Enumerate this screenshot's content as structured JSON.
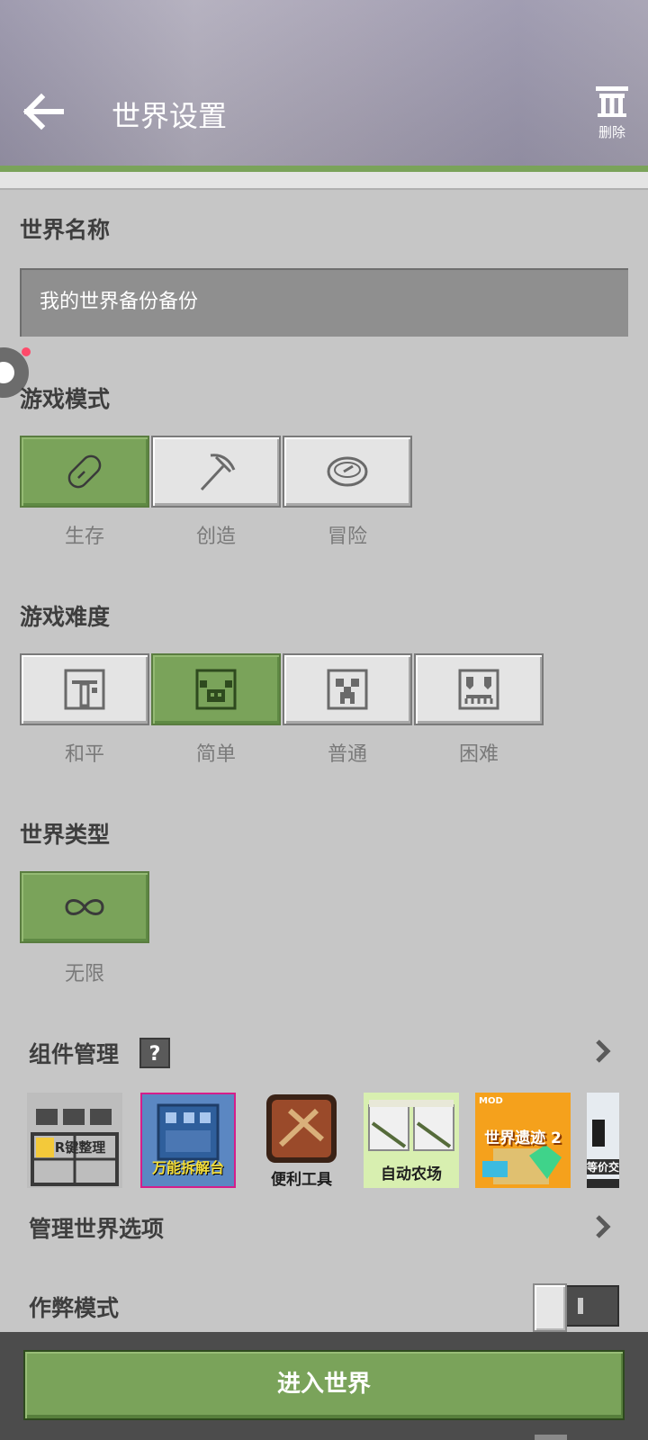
{
  "header": {
    "title": "世界设置",
    "delete_label": "删除"
  },
  "world_name": {
    "section_title": "世界名称",
    "value": "我的世界备份备份"
  },
  "game_mode": {
    "section_title": "游戏模式",
    "options": [
      {
        "label": "生存",
        "icon": "bread-icon",
        "selected": true
      },
      {
        "label": "创造",
        "icon": "pickaxe-icon",
        "selected": false
      },
      {
        "label": "冒险",
        "icon": "compass-icon",
        "selected": false
      }
    ]
  },
  "difficulty": {
    "section_title": "游戏难度",
    "options": [
      {
        "label": "和平",
        "icon": "peaceful-mob-icon",
        "selected": false
      },
      {
        "label": "简单",
        "icon": "pig-icon",
        "selected": true
      },
      {
        "label": "普通",
        "icon": "creeper-icon",
        "selected": false
      },
      {
        "label": "困难",
        "icon": "ghast-icon",
        "selected": false
      }
    ]
  },
  "world_type": {
    "section_title": "世界类型",
    "options": [
      {
        "label": "无限",
        "icon": "infinity-icon",
        "selected": true
      }
    ]
  },
  "components": {
    "title": "组件管理",
    "help": "?",
    "mods": [
      {
        "text": "R键整理",
        "name": "mod-r-key-sort"
      },
      {
        "text": "万能拆解台",
        "name": "mod-universal-disassembler"
      },
      {
        "text": "便利工具",
        "name": "mod-convenient-tools"
      },
      {
        "text": "自动农场",
        "name": "mod-auto-farm"
      },
      {
        "text": "世界遗迹 2",
        "name": "mod-world-relics-2",
        "badge": "MOD"
      },
      {
        "text": "等价交",
        "name": "mod-equivalent-exchange"
      }
    ]
  },
  "manage_options": {
    "title": "管理世界选项"
  },
  "cheat_mode": {
    "title": "作弊模式",
    "enabled": false
  },
  "enter_button": {
    "label": "进入世界"
  },
  "colors": {
    "accent_green": "#7aa35a",
    "background": "#c6c6c6",
    "dark_bar": "#4c4c4c"
  }
}
